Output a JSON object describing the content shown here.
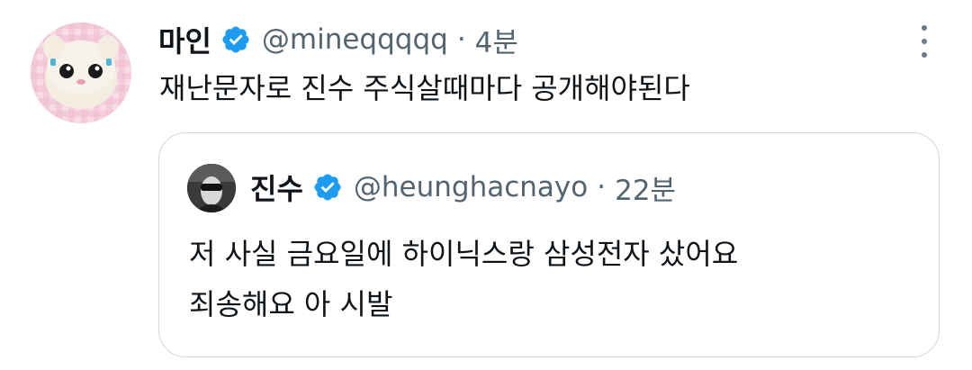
{
  "tweet": {
    "display_name": "마인",
    "handle": "@mineqqqqq",
    "separator": "·",
    "time": "4분",
    "text": "재난문자로 진수 주식살때마다 공개해야된다",
    "verified_color": "#1d9bf0"
  },
  "quote": {
    "display_name": "진수",
    "handle": "@heunghacnayo",
    "separator": "·",
    "time": "22분",
    "text_lines": [
      "저 사실 금요일에 하이닉스랑 삼성전자 샀어요",
      "죄송해요 아 시발"
    ]
  },
  "icons": {
    "verified": "verified-badge-icon",
    "more": "more-options-icon"
  }
}
